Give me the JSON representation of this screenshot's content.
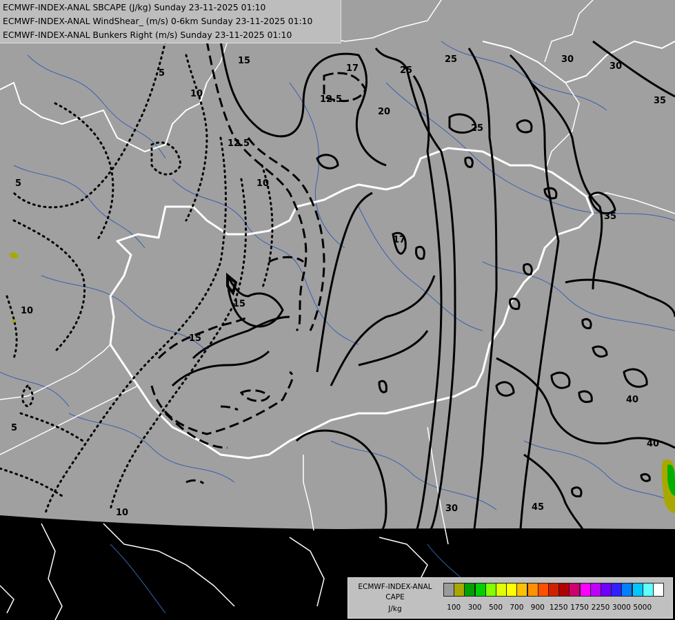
{
  "header": {
    "lines": [
      "ECMWF-INDEX-ANAL SBCAPE (J/kg) Sunday 23-11-2025 01:10",
      "ECMWF-INDEX-ANAL WindShear_ (m/s) 0-6km Sunday 23-11-2025 01:10",
      "ECMWF-INDEX-ANAL Bunkers Right (m/s) Sunday 23-11-2025 01:10"
    ]
  },
  "contour_labels": {
    "windshear": [
      "15",
      "17",
      "17",
      "20",
      "25",
      "25",
      "25",
      "30",
      "30",
      "35",
      "35",
      "40",
      "40",
      "45",
      "30"
    ],
    "bunkers": [
      "12.5",
      "12.5",
      "10",
      "10",
      "15",
      "15"
    ],
    "dotted": [
      "5",
      "10",
      "5",
      "5",
      "10"
    ]
  },
  "legend": {
    "title_lines": [
      "ECMWF-INDEX-ANAL",
      "CAPE",
      "J/kg"
    ],
    "colors": [
      "#9a9a9a",
      "#a8a800",
      "#00a000",
      "#00d000",
      "#80ff00",
      "#e0ff00",
      "#ffff00",
      "#ffc000",
      "#ff9000",
      "#ff5000",
      "#d02000",
      "#b00000",
      "#d00070",
      "#ff00ff",
      "#c000ff",
      "#7000ff",
      "#3020ff",
      "#0080ff",
      "#00c8ff",
      "#60ffff",
      "#ffffff"
    ],
    "ticks": [
      "100",
      "300",
      "500",
      "700",
      "900",
      "1250",
      "1750",
      "2250",
      "3000",
      "5000"
    ]
  },
  "colors": {
    "domain_fill": "#a0a0a0",
    "outside": "#000000",
    "rivers": "#3a5fb0",
    "borders": "#ffffff",
    "contours": "#000000"
  }
}
